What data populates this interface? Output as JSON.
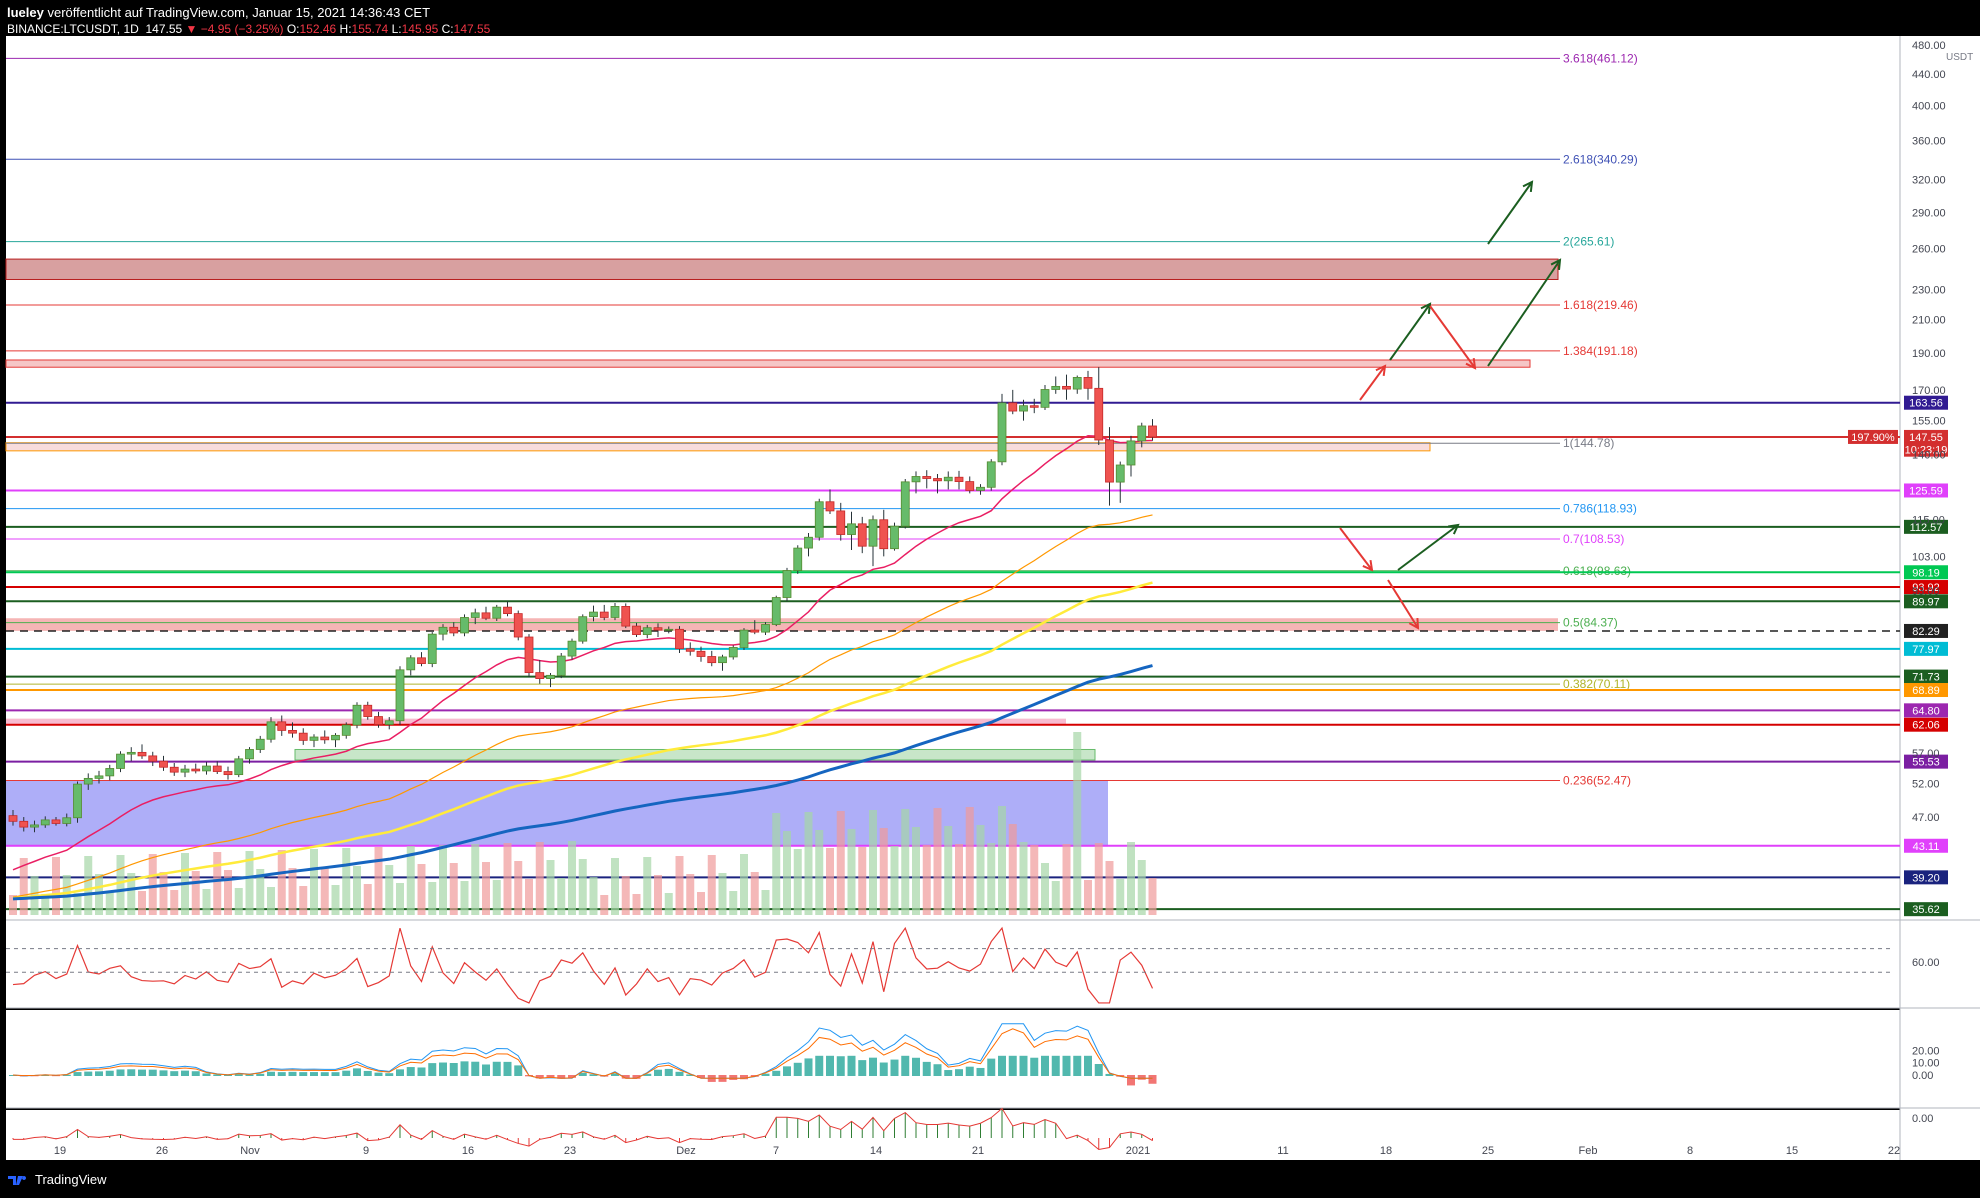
{
  "header": {
    "author": "lueley",
    "published": "veröffentlicht auf TradingView.com, Januar 15, 2021 14:36:43 CET",
    "symbol": "BINANCE:LTCUSDT, 1D",
    "last": "147.55",
    "change": "▼ −4.95 (−3.25%)",
    "open_label": "O:",
    "open": "152.46",
    "high_label": "H:",
    "high": "155.74",
    "low_label": "L:",
    "low": "145.95",
    "close_label": "C:",
    "close": "147.55"
  },
  "footer": {
    "brand": "TradingView",
    "logo_icon": "tradingview-logo-icon"
  },
  "colors": {
    "background": "#ffffff",
    "up": "#2e7d32",
    "down": "#e53935",
    "ema20": "#e91e63",
    "ema50": "#ff9800",
    "ema100": "#ffeb3b",
    "ema200": "#1565c0"
  },
  "chart_data": [
    {
      "type": "candlestick",
      "title": "BINANCE:LTCUSDT, 1D",
      "y_scale": "log",
      "ylim": [
        35,
        480
      ],
      "y_ticks": [
        "480.00",
        "440.00",
        "400.00",
        "360.00",
        "320.00",
        "290.00",
        "260.00",
        "230.00",
        "210.00",
        "190.00",
        "170.00",
        "155.00",
        "140.00",
        "115.00",
        "103.00",
        "93.00",
        "52.00",
        "47.00",
        "57.00"
      ],
      "x_ticks": [
        "19",
        "26",
        "Nov",
        "9",
        "16",
        "23",
        "Dez",
        "7",
        "14",
        "21",
        "2021",
        "11",
        "18",
        "25",
        "Feb",
        "8",
        "15",
        "22"
      ],
      "currency_badge": "USDT",
      "fib_levels": [
        {
          "label": "3.618(461.12)",
          "value": 461.12,
          "color": "#9c27b0"
        },
        {
          "label": "2.618(340.29)",
          "value": 340.29,
          "color": "#3f51b5"
        },
        {
          "label": "2(265.61)",
          "value": 265.61,
          "color": "#26a69a"
        },
        {
          "label": "1.618(219.46)",
          "value": 219.46,
          "color": "#e53935"
        },
        {
          "label": "1.384(191.18)",
          "value": 191.18,
          "color": "#e53935"
        },
        {
          "label": "1(144.78)",
          "value": 144.78,
          "color": "#787b86"
        },
        {
          "label": "0.786(118.93)",
          "value": 118.93,
          "color": "#2196f3"
        },
        {
          "label": "0.7(108.53)",
          "value": 108.53,
          "color": "#e040fb"
        },
        {
          "label": "0.618(98.63)",
          "value": 98.63,
          "color": "#4caf50"
        },
        {
          "label": "0.5(84.37)",
          "value": 84.37,
          "color": "#4caf50"
        },
        {
          "label": "0.382(70.11)",
          "value": 70.11,
          "color": "#afb42b"
        },
        {
          "label": "0.236(52.47)",
          "value": 52.47,
          "color": "#e53935"
        }
      ],
      "price_labels": [
        {
          "text": "163.56",
          "value": 163.56,
          "color": "#311b92"
        },
        {
          "text": "147.55",
          "value": 147.55,
          "color": "#d32f2f"
        },
        {
          "text": "197.90%",
          "value": 147.55,
          "color": "#d32f2f"
        },
        {
          "text": "10:23:19",
          "value": 142.0,
          "color": "#d32f2f"
        },
        {
          "text": "125.59",
          "value": 125.59,
          "color": "#e040fb"
        },
        {
          "text": "112.57",
          "value": 112.57,
          "color": "#1b5e20"
        },
        {
          "text": "98.19",
          "value": 98.19,
          "color": "#00c853"
        },
        {
          "text": "93.92",
          "value": 93.92,
          "color": "#d50000"
        },
        {
          "text": "89.97",
          "value": 89.97,
          "color": "#1b5e20"
        },
        {
          "text": "82.29",
          "value": 82.29,
          "color": "#212121"
        },
        {
          "text": "77.97",
          "value": 77.97,
          "color": "#00bcd4"
        },
        {
          "text": "71.73",
          "value": 71.73,
          "color": "#1b5e20"
        },
        {
          "text": "68.89",
          "value": 68.89,
          "color": "#ff9800"
        },
        {
          "text": "64.80",
          "value": 64.8,
          "color": "#9c27b0"
        },
        {
          "text": "62.06",
          "value": 62.06,
          "color": "#d50000"
        },
        {
          "text": "55.53",
          "value": 55.53,
          "color": "#7b1fa2"
        },
        {
          "text": "43.11",
          "value": 43.11,
          "color": "#e040fb"
        },
        {
          "text": "39.20",
          "value": 39.2,
          "color": "#1a237e"
        },
        {
          "text": "35.62",
          "value": 35.62,
          "color": "#1b5e20"
        }
      ],
      "candles": [
        [
          47.2,
          48.0,
          45.8,
          46.4
        ],
        [
          46.4,
          47.0,
          45.0,
          45.6
        ],
        [
          45.6,
          46.5,
          44.9,
          45.9
        ],
        [
          45.9,
          47.1,
          45.5,
          46.6
        ],
        [
          46.6,
          47.0,
          45.8,
          46.1
        ],
        [
          46.1,
          47.5,
          45.7,
          46.9
        ],
        [
          46.9,
          52.3,
          46.2,
          51.9
        ],
        [
          51.9,
          53.6,
          51.0,
          52.8
        ],
        [
          52.8,
          54.0,
          52.0,
          53.2
        ],
        [
          53.2,
          55.0,
          52.5,
          54.4
        ],
        [
          54.4,
          57.3,
          53.8,
          56.8
        ],
        [
          56.8,
          58.0,
          55.6,
          57.1
        ],
        [
          57.1,
          58.5,
          56.0,
          56.5
        ],
        [
          56.5,
          57.2,
          54.8,
          55.6
        ],
        [
          55.6,
          56.5,
          54.0,
          54.6
        ],
        [
          54.6,
          55.3,
          53.2,
          53.8
        ],
        [
          53.8,
          55.0,
          53.0,
          54.3
        ],
        [
          54.3,
          55.2,
          53.6,
          54.0
        ],
        [
          54.0,
          55.5,
          53.4,
          54.8
        ],
        [
          54.8,
          55.6,
          53.5,
          53.9
        ],
        [
          53.9,
          54.7,
          52.6,
          53.4
        ],
        [
          53.4,
          56.5,
          53.0,
          56.0
        ],
        [
          56.0,
          58.0,
          55.2,
          57.6
        ],
        [
          57.6,
          60.0,
          57.0,
          59.4
        ],
        [
          59.4,
          63.5,
          58.8,
          62.6
        ],
        [
          62.6,
          63.8,
          60.0,
          61.0
        ],
        [
          61.0,
          62.5,
          59.7,
          60.5
        ],
        [
          60.5,
          61.4,
          58.4,
          59.2
        ],
        [
          59.2,
          60.3,
          58.0,
          59.8
        ],
        [
          59.8,
          61.0,
          58.6,
          59.3
        ],
        [
          59.3,
          60.5,
          58.0,
          60.1
        ],
        [
          60.1,
          62.5,
          59.5,
          62.0
        ],
        [
          62.0,
          66.4,
          61.4,
          65.8
        ],
        [
          65.8,
          66.5,
          63.0,
          63.6
        ],
        [
          63.6,
          64.5,
          61.5,
          62.1
        ],
        [
          62.1,
          63.5,
          61.2,
          62.8
        ],
        [
          62.8,
          74.0,
          62.0,
          73.2
        ],
        [
          73.2,
          76.5,
          72.0,
          75.9
        ],
        [
          75.9,
          77.2,
          74.0,
          74.6
        ],
        [
          74.6,
          82.0,
          73.8,
          81.5
        ],
        [
          81.5,
          84.0,
          80.0,
          83.2
        ],
        [
          83.2,
          84.5,
          81.0,
          81.8
        ],
        [
          81.8,
          86.5,
          81.0,
          85.7
        ],
        [
          85.7,
          88.0,
          84.0,
          86.9
        ],
        [
          86.9,
          88.5,
          85.0,
          85.5
        ],
        [
          85.5,
          89.0,
          84.8,
          88.4
        ],
        [
          88.4,
          90.0,
          86.0,
          86.7
        ],
        [
          86.7,
          87.5,
          80.0,
          80.8
        ],
        [
          80.8,
          81.5,
          71.6,
          72.6
        ],
        [
          72.6,
          75.4,
          70.2,
          71.3
        ],
        [
          71.3,
          72.5,
          69.5,
          72.0
        ],
        [
          72.0,
          77.0,
          71.4,
          76.3
        ],
        [
          76.3,
          80.4,
          75.5,
          79.8
        ],
        [
          79.8,
          86.5,
          79.2,
          85.9
        ],
        [
          85.9,
          88.8,
          84.7,
          87.1
        ],
        [
          87.1,
          89.0,
          85.0,
          85.7
        ],
        [
          85.7,
          89.5,
          85.0,
          88.6
        ],
        [
          88.6,
          89.4,
          83.0,
          83.5
        ],
        [
          83.5,
          84.3,
          80.8,
          81.4
        ],
        [
          81.4,
          83.8,
          80.5,
          83.1
        ],
        [
          83.1,
          84.2,
          80.8,
          82.5
        ],
        [
          82.5,
          83.4,
          81.7,
          82.7
        ],
        [
          82.7,
          83.5,
          77.0,
          78.0
        ],
        [
          78.0,
          79.5,
          76.4,
          77.4
        ],
        [
          77.4,
          78.5,
          75.0,
          76.2
        ],
        [
          76.2,
          77.5,
          74.0,
          74.8
        ],
        [
          74.8,
          76.6,
          73.0,
          76.1
        ],
        [
          76.1,
          78.8,
          75.5,
          78.3
        ],
        [
          78.3,
          83.0,
          77.7,
          82.5
        ],
        [
          82.5,
          85.0,
          81.5,
          82.0
        ],
        [
          82.0,
          84.5,
          81.3,
          83.9
        ],
        [
          83.9,
          91.5,
          83.5,
          91.0
        ],
        [
          91.0,
          99.5,
          90.0,
          98.7
        ],
        [
          98.7,
          106.5,
          97.7,
          105.6
        ],
        [
          105.6,
          110.5,
          103.0,
          109.1
        ],
        [
          109.1,
          122.5,
          108.0,
          121.4
        ],
        [
          121.4,
          126.0,
          117.0,
          118.1
        ],
        [
          118.1,
          121.0,
          108.0,
          110.0
        ],
        [
          110.0,
          117.8,
          105.0,
          113.6
        ],
        [
          113.6,
          116.0,
          104.0,
          106.2
        ],
        [
          106.2,
          116.5,
          100.0,
          115.0
        ],
        [
          115.0,
          118.5,
          103.0,
          105.4
        ],
        [
          105.4,
          114.0,
          104.8,
          112.8
        ],
        [
          112.8,
          130.0,
          112.0,
          128.9
        ],
        [
          128.9,
          133.0,
          124.5,
          131.0
        ],
        [
          131.0,
          133.5,
          126.4,
          130.2
        ],
        [
          130.2,
          132.0,
          124.5,
          129.3
        ],
        [
          129.3,
          133.0,
          126.0,
          130.7
        ],
        [
          130.7,
          133.2,
          126.0,
          129.0
        ],
        [
          129.0,
          131.0,
          124.5,
          125.6
        ],
        [
          125.6,
          128.0,
          124.0,
          126.8
        ],
        [
          126.8,
          138.0,
          125.5,
          136.9
        ],
        [
          136.9,
          168.0,
          135.5,
          163.5
        ],
        [
          163.5,
          170.0,
          158.0,
          159.5
        ],
        [
          159.5,
          165.0,
          155.0,
          162.1
        ],
        [
          162.1,
          165.5,
          158.5,
          161.3
        ],
        [
          161.3,
          172.5,
          160.0,
          170.2
        ],
        [
          170.2,
          177.0,
          168.0,
          171.8
        ],
        [
          171.8,
          178.0,
          165.0,
          170.4
        ],
        [
          170.4,
          177.5,
          168.0,
          176.5
        ],
        [
          176.5,
          180.0,
          165.0,
          170.8
        ],
        [
          170.8,
          182.0,
          144.0,
          146.2
        ],
        [
          146.2,
          152.0,
          120.0,
          128.8
        ],
        [
          128.8,
          137.0,
          121.0,
          135.6
        ],
        [
          135.6,
          148.0,
          131.0,
          145.8
        ],
        [
          145.8,
          154.0,
          143.0,
          152.5
        ],
        [
          152.5,
          155.7,
          145.9,
          147.55
        ]
      ],
      "annotations": {
        "author_note": "",
        "arrows": "projected scenario arrows (green up / red down)"
      }
    }
  ]
}
